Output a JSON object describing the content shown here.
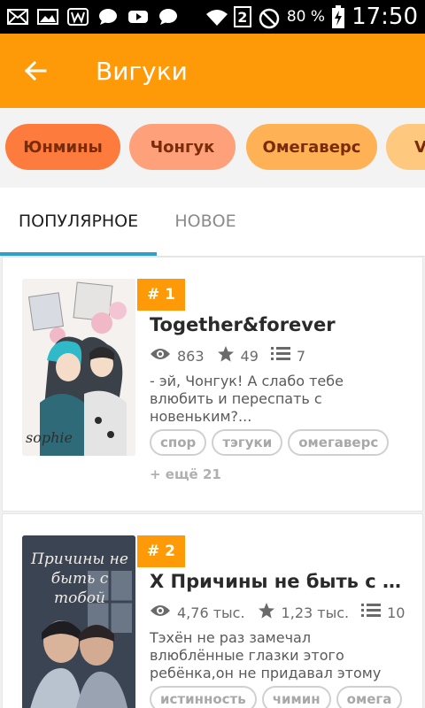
{
  "status_bar": {
    "battery": "80 %",
    "sim": "2",
    "time": "17:50"
  },
  "toolbar": {
    "title": "Вигуки"
  },
  "tag_chips": [
    {
      "label": "Юнмины",
      "bg": "#fd7b3c"
    },
    {
      "label": "Чонгук",
      "bg": "#fea07a"
    },
    {
      "label": "Омегаверс",
      "bg": "#feb255"
    },
    {
      "label": "V",
      "bg": "#fec97e"
    }
  ],
  "tabs": [
    {
      "label": "ПОПУЛЯРНОЕ",
      "active": true
    },
    {
      "label": "НОВОЕ",
      "active": false
    }
  ],
  "colors": {
    "accent": "#fe9a08",
    "tab_indicator": "#2fa0c8"
  },
  "stories": [
    {
      "rank": "# 1",
      "title": "Together&forever",
      "views": "863",
      "votes": "49",
      "parts": "7",
      "description": "- эй, Чонгук! А слабо тебе влюбить и переспать с новеньким?...",
      "tags": [
        "спор",
        "тэгуки",
        "омегаверс"
      ],
      "more": "+ ещё 21",
      "cover_text": "sophie"
    },
    {
      "rank": "# 2",
      "title": "X Причины не быть с тобой",
      "views": "4,76 тыс.",
      "votes": "1,23 тыс.",
      "parts": "10",
      "description": "Тэхён не раз замечал влюблённые глазки этого ребёнка,он не придавал этому значения",
      "tags": [
        "истинность",
        "чимин",
        "омега"
      ],
      "cover_text": "Причины не быть с тобой"
    }
  ]
}
